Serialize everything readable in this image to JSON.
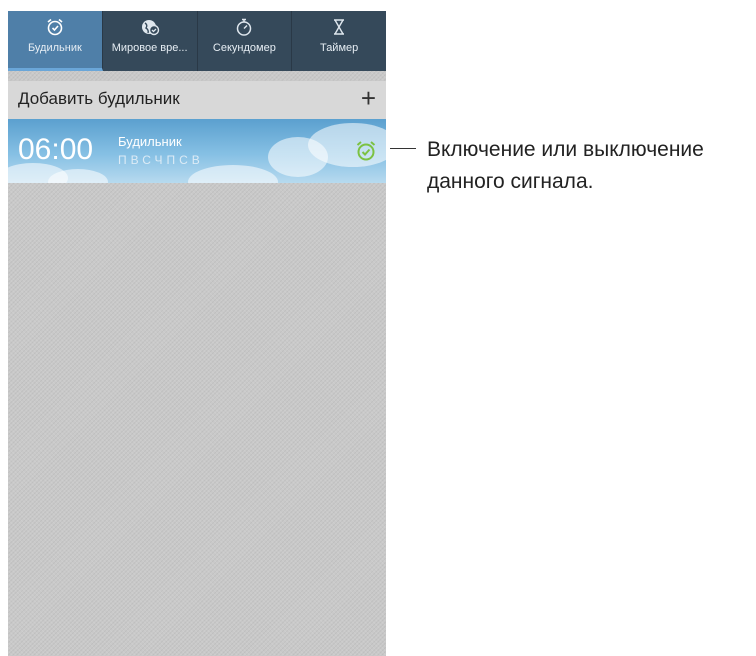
{
  "tabs": [
    {
      "label": "Будильник",
      "icon": "alarm-clock-icon",
      "active": true
    },
    {
      "label": "Мировое вре...",
      "icon": "world-clock-icon",
      "active": false
    },
    {
      "label": "Секундомер",
      "icon": "stopwatch-icon",
      "active": false
    },
    {
      "label": "Таймер",
      "icon": "hourglass-icon",
      "active": false
    }
  ],
  "add_alarm": {
    "label": "Добавить будильник",
    "plus": "+"
  },
  "alarm": {
    "time": "06:00",
    "name": "Будильник",
    "days": "ПВСЧПСВ",
    "enabled": true,
    "toggle_icon": "alarm-toggle-icon",
    "toggle_color": "#7cc242"
  },
  "callout": {
    "line1": "Включение или выключение",
    "line2": "данного сигнала."
  },
  "colors": {
    "tab_bar": "#35495a",
    "tab_active": "#4f7fa8"
  }
}
